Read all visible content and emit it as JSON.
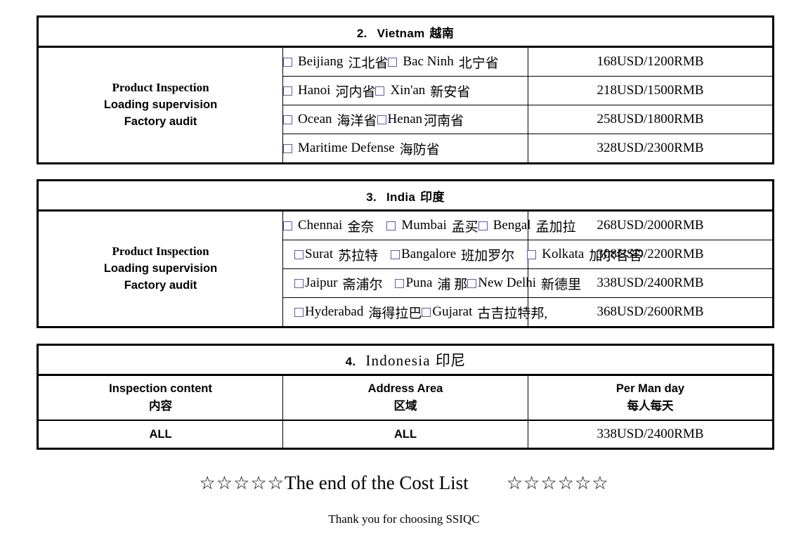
{
  "document": {
    "type": "cost-list",
    "tables": [
      {
        "id": "vietnam",
        "title": {
          "number": "2.",
          "name": "Vietnam",
          "cn": "越南"
        },
        "services": {
          "line1": "Product Inspection",
          "line2": "Loading supervision",
          "line3": "Factory audit"
        },
        "rows": [
          {
            "options": [
              {
                "label": "Beijiang",
                "cn": "江北省"
              },
              {
                "label": "Bac Ninh",
                "cn": "北宁省"
              }
            ],
            "price": "168USD/1200RMB"
          },
          {
            "options": [
              {
                "label": "Hanoi",
                "cn": "河内省"
              },
              {
                "label": "Xin'an",
                "cn": "新安省"
              }
            ],
            "price": "218USD/1500RMB"
          },
          {
            "options": [
              {
                "label": "Ocean",
                "cn": "海洋省"
              },
              {
                "label": "Henan",
                "cn": "河南省"
              }
            ],
            "price": "258USD/1800RMB"
          },
          {
            "options": [
              {
                "label": "Maritime Defense",
                "cn": "海防省"
              }
            ],
            "price": "328USD/2300RMB"
          }
        ]
      },
      {
        "id": "india",
        "title": {
          "number": "3.",
          "name": "India",
          "cn": "印度"
        },
        "services": {
          "line1": "Product Inspection",
          "line2": "Loading supervision",
          "line3": "Factory audit"
        },
        "rows": [
          {
            "options": [
              {
                "label": "Chennai",
                "cn": "金奈"
              },
              {
                "label": "Mumbai",
                "cn": "孟买"
              },
              {
                "label": "Bengal",
                "cn": "孟加拉"
              }
            ],
            "price": "268USD/2000RMB"
          },
          {
            "options": [
              {
                "label": "Surat",
                "cn": "苏拉特"
              },
              {
                "label": "Bangalore",
                "cn": "班加罗尔"
              },
              {
                "label": "Kolkata",
                "cn": "加尔各答"
              }
            ],
            "price": "308USD/2200RMB"
          },
          {
            "options": [
              {
                "label": "Jaipur",
                "cn": "斋浦尔"
              },
              {
                "label": "Puna",
                "cn": "浦 那"
              },
              {
                "label": "New Delhi",
                "cn": "新德里"
              }
            ],
            "price": "338USD/2400RMB"
          },
          {
            "options": [
              {
                "label": "Hyderabad",
                "cn": "海得拉巴"
              },
              {
                "label": "Gujarat",
                "cn": "古吉拉特邦,"
              }
            ],
            "price": "368USD/2600RMB"
          }
        ]
      },
      {
        "id": "indonesia",
        "title": {
          "number": "4.",
          "name": "Indonesia",
          "cn": "印尼"
        },
        "headers": {
          "content_en": "Inspection content",
          "content_cn": "内容",
          "area_en": "Address Area",
          "area_cn": "区域",
          "price_en": "Per Man day",
          "price_cn": "每人每天"
        },
        "row": {
          "content": "ALL",
          "area": "ALL",
          "price": "338USD/2400RMB"
        }
      }
    ]
  },
  "footer": {
    "stars_left": "☆☆☆☆☆",
    "end_text": "The end of the Cost List",
    "stars_right": "☆☆☆☆☆☆",
    "thanks": "Thank you for choosing SSIQC"
  },
  "colors": {
    "text": "#000000",
    "checkbox_border": "#5a5ab4",
    "table_border": "#000000",
    "background": "#ffffff"
  }
}
